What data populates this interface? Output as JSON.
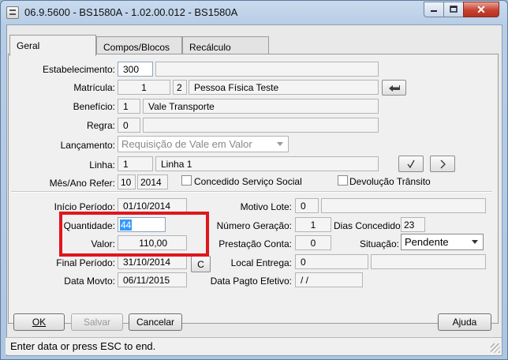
{
  "window": {
    "title": "06.9.5600 - BS1580A - 1.02.00.012 - BS1580A",
    "minimize_icon": "minimize-icon",
    "maximize_icon": "maximize-icon",
    "close_label": "✕"
  },
  "tabs": [
    {
      "label": "Geral",
      "active": true
    },
    {
      "label": "Compos/Blocos",
      "active": false
    },
    {
      "label": "Recálculo",
      "active": false
    }
  ],
  "form": {
    "estabelecimento_label": "Estabelecimento:",
    "estabelecimento_value": "300",
    "estabelecimento_desc": "",
    "matricula_label": "Matrícula:",
    "matricula_value": "1",
    "matricula_seq": "2",
    "matricula_desc": "Pessoa Física Teste",
    "beneficio_label": "Benefício:",
    "beneficio_value": "1",
    "beneficio_desc": "Vale Transporte",
    "regra_label": "Regra:",
    "regra_value": "0",
    "regra_desc": "",
    "lancamento_label": "Lançamento:",
    "lancamento_value": "Requisição de Vale em Valor",
    "linha_label": "Linha:",
    "linha_value": "1",
    "linha_desc": "Linha 1",
    "mes_ano_label": "Mês/Ano Refer:",
    "mes_value": "10",
    "ano_value": "2014",
    "concedido_label": "Concedido Serviço Social",
    "devolucao_label": "Devolução Trânsito"
  },
  "details": {
    "inicio_label": "Início Período:",
    "inicio_value": "01/10/2014",
    "quantidade_label": "Quantidade:",
    "quantidade_value": "44",
    "valor_label": "Valor:",
    "valor_value": "110,00",
    "final_label": "Final Período:",
    "final_value": "31/10/2014",
    "c_button_label": "C",
    "data_movto_label": "Data Movto:",
    "data_movto_value": "06/11/2015",
    "motivo_lote_label": "Motivo Lote:",
    "motivo_lote_value": "0",
    "motivo_lote_desc": "",
    "numero_geracao_label": "Número Geração:",
    "numero_geracao_value": "1",
    "dias_concedidos_label": "Dias Concedidos:",
    "dias_concedidos_value": "23",
    "prestacao_label": "Prestação Conta:",
    "prestacao_value": "0",
    "situacao_label": "Situação:",
    "situacao_value": "Pendente",
    "local_entrega_label": "Local Entrega:",
    "local_entrega_value": "0",
    "local_entrega_desc": "",
    "data_pagto_label": "Data Pagto Efetivo:",
    "data_pagto_value": "/ /"
  },
  "buttons": {
    "ok": "OK",
    "salvar": "Salvar",
    "cancelar": "Cancelar",
    "ajuda": "Ajuda"
  },
  "status": "Enter data or press ESC to end.",
  "colors": {
    "highlight": "#e0161d",
    "selection": "#3399ff",
    "close_button": "#c7422f"
  }
}
